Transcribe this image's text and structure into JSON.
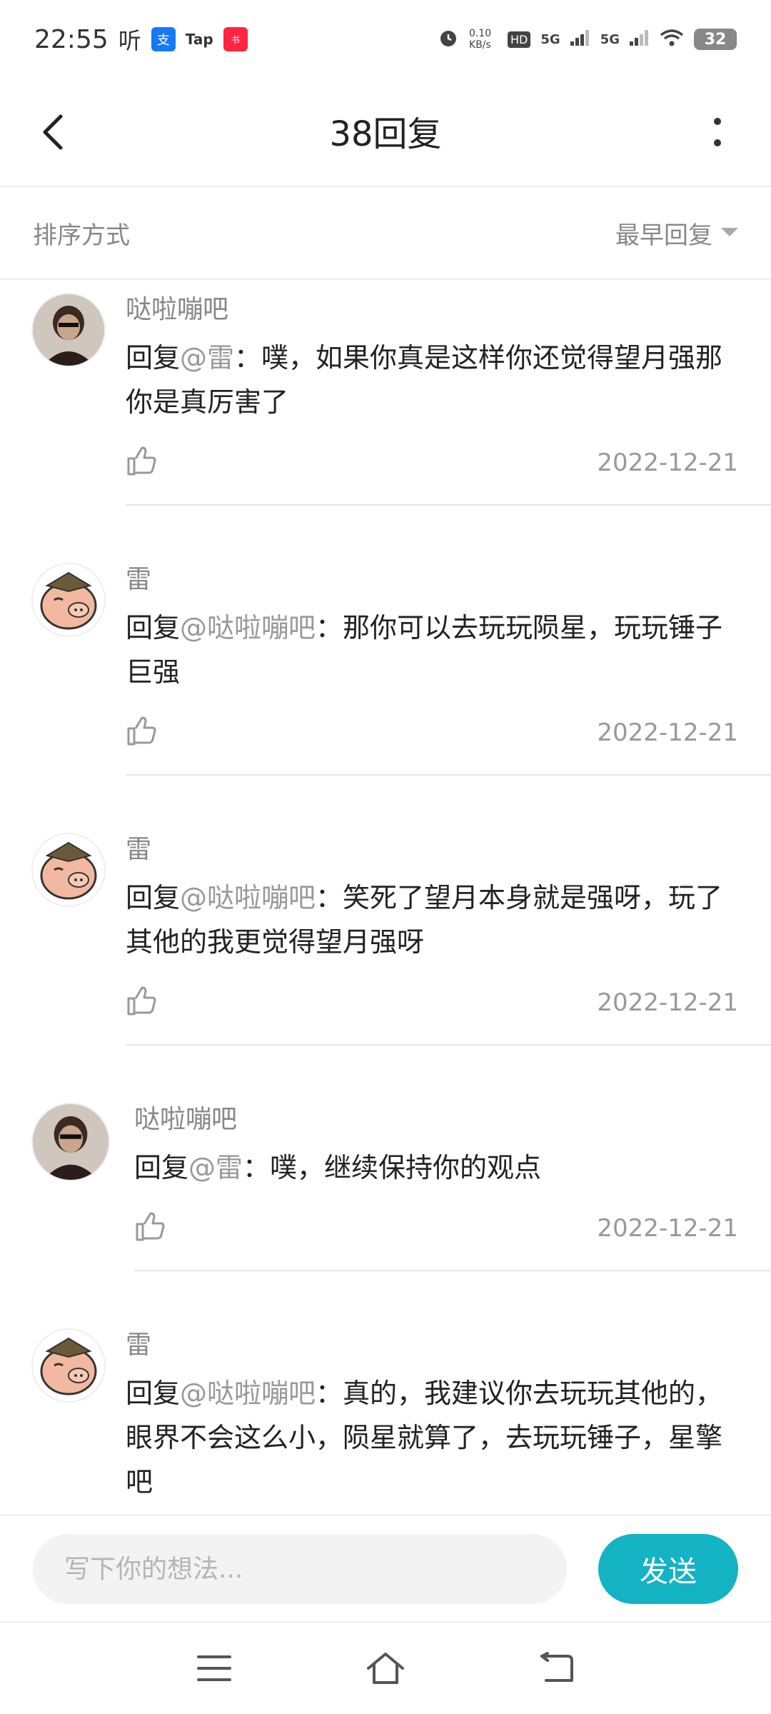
{
  "status_bar": {
    "time": "22:55",
    "app_text_1": "听",
    "app_text_2": "Tap",
    "network_speed": "0.10 KB/s",
    "signal_1": "5G",
    "signal_2": "5G",
    "battery": "32"
  },
  "header": {
    "title": "38回复"
  },
  "sort": {
    "label": "排序方式",
    "value": "最早回复"
  },
  "replies": [
    {
      "user": "哒啦嘣吧",
      "prefix": "回复",
      "mention": "@雷",
      "text": "：噗，如果你真是这样你还觉得望月强那你是真厉害了",
      "date": "2022-12-21"
    },
    {
      "user": "雷",
      "prefix": "回复",
      "mention": "@哒啦嘣吧",
      "text": "：那你可以去玩玩陨星，玩玩锤子巨强",
      "date": "2022-12-21"
    },
    {
      "user": "雷",
      "prefix": "回复",
      "mention": "@哒啦嘣吧",
      "text": "：笑死了望月本身就是强呀，玩了其他的我更觉得望月强呀",
      "date": "2022-12-21"
    },
    {
      "user": "哒啦嘣吧",
      "prefix": "回复",
      "mention": "@雷",
      "text": "：噗，继续保持你的观点",
      "date": "2022-12-21"
    },
    {
      "user": "雷",
      "prefix": "回复",
      "mention": "@哒啦嘣吧",
      "text": "：真的，我建议你去玩玩其他的，眼界不会这么小，陨星就算了，去玩玩锤子，星擎吧",
      "date": "2022-12-21"
    }
  ],
  "composer": {
    "placeholder": "写下你的想法...",
    "send_label": "发送"
  },
  "colors": {
    "accent": "#13b3c4"
  }
}
